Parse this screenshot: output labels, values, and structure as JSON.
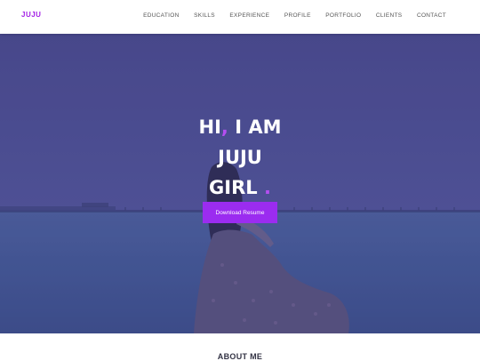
{
  "brand": "JUJU",
  "nav": {
    "items": [
      {
        "label": "EDUCATION"
      },
      {
        "label": "SKILLS"
      },
      {
        "label": "EXPERIENCE"
      },
      {
        "label": "PROFILE"
      },
      {
        "label": "PORTFOLIO"
      },
      {
        "label": "CLIENTS"
      },
      {
        "label": "CONTACT"
      }
    ]
  },
  "hero": {
    "line1_a": "HI",
    "line1_comma": ",",
    "line1_b": " I AM",
    "line2": "JUJU",
    "line3": "GIRL",
    "line3_dot": ".",
    "button": "Download Resume"
  },
  "about": {
    "title": "ABOUT ME"
  },
  "colors": {
    "accent": "#a21de5",
    "button": "#9b2cf0",
    "overlay": "#4f4f8e"
  }
}
